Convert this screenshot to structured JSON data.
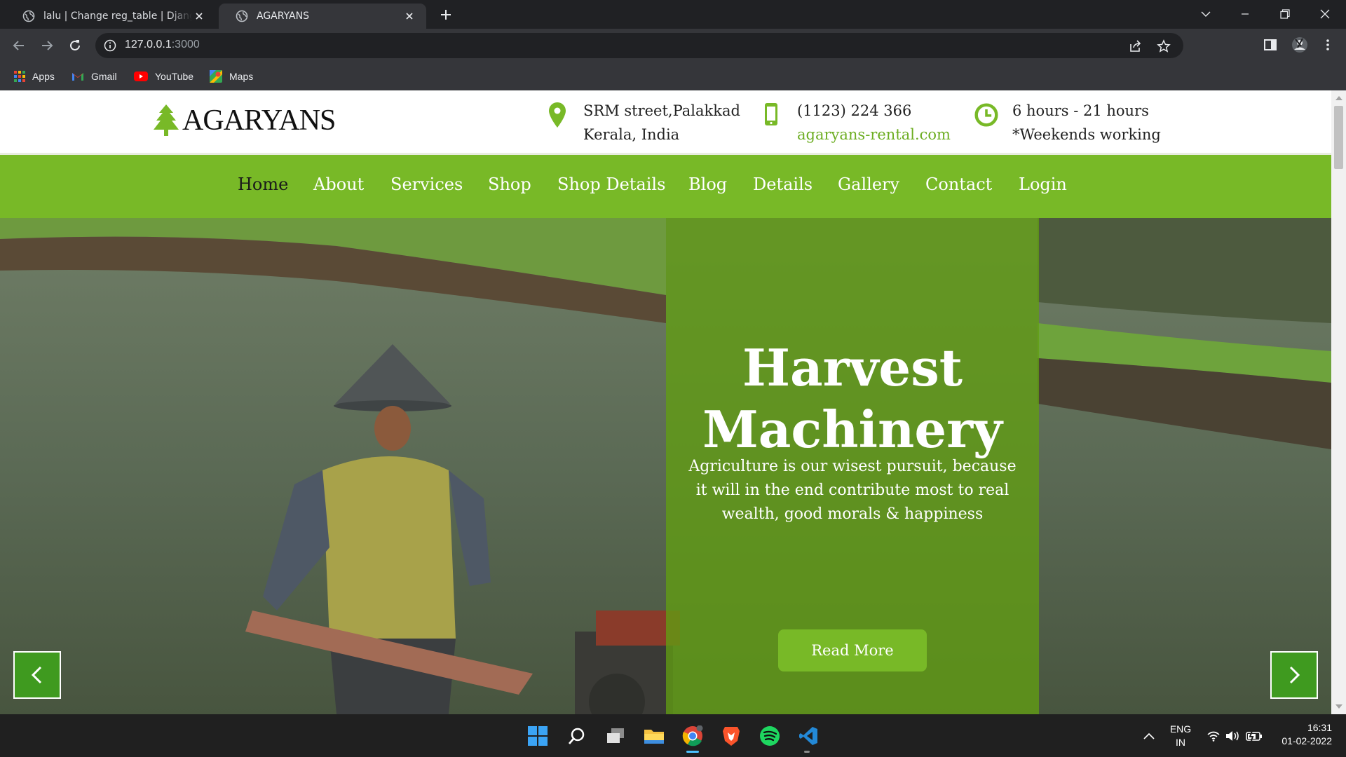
{
  "browser": {
    "tabs": [
      {
        "title": "lalu | Change reg_table | Django site admin",
        "active": false
      },
      {
        "title": "AGARYANS",
        "active": true
      }
    ],
    "url_host": "127.0.0.1",
    "url_port": ":3000",
    "bookmarks": [
      {
        "label": "Apps",
        "icon": "apps-grid-icon"
      },
      {
        "label": "Gmail",
        "icon": "gmail-icon"
      },
      {
        "label": "YouTube",
        "icon": "youtube-icon"
      },
      {
        "label": "Maps",
        "icon": "maps-icon"
      }
    ]
  },
  "site": {
    "brand": "AGARYANS",
    "contact": {
      "address_line1": "SRM street,Palakkad",
      "address_line2": "Kerala, India",
      "phone": "(1123) 224 366",
      "website": "agaryans-rental.com",
      "hours": "6 hours - 21 hours",
      "hours_note": "*Weekends working"
    },
    "nav": [
      {
        "label": "Home",
        "active": true
      },
      {
        "label": "About"
      },
      {
        "label": "Services"
      },
      {
        "label": "Shop"
      },
      {
        "label": "Shop Details"
      },
      {
        "label": "Blog"
      },
      {
        "label": "Details"
      },
      {
        "label": "Gallery"
      },
      {
        "label": "Contact"
      },
      {
        "label": "Login"
      }
    ],
    "hero": {
      "title_line1": "Harvest",
      "title_line2": "Machinery",
      "text": "Agriculture is our wisest pursuit, because it will in the end contribute most to real wealth, good morals & happiness",
      "button": "Read More"
    },
    "colors": {
      "brand_green": "#78b927",
      "panel_green": "#629e12",
      "link_green": "#6cad21"
    }
  },
  "taskbar": {
    "language": "ENG",
    "region": "IN",
    "time": "16:31",
    "date": "01-02-2022"
  }
}
